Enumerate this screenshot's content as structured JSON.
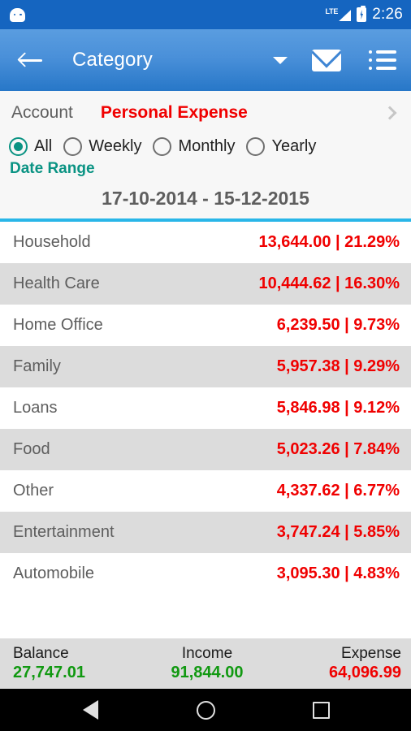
{
  "status_bar": {
    "left_icon": "android-head-icon",
    "network_label": "LTE",
    "signal_icon": "signal-triangle-icon",
    "battery_icon": "battery-charging-icon",
    "time": "2:26"
  },
  "toolbar": {
    "back_icon": "back-arrow-icon",
    "title": "Category",
    "dropdown_icon": "chevron-down-icon",
    "mail_icon": "mail-icon",
    "list_icon": "list-icon"
  },
  "filters": {
    "account_label": "Account",
    "account_value": "Personal Expense",
    "chevron_icon": "chevron-right-icon",
    "period_options": [
      {
        "label": "All",
        "selected": true
      },
      {
        "label": "Weekly",
        "selected": false
      },
      {
        "label": "Monthly",
        "selected": false
      },
      {
        "label": "Yearly",
        "selected": false
      }
    ],
    "date_range_label": "Date Range",
    "date_range_value": "17-10-2014 - 15-12-2015"
  },
  "categories": [
    {
      "name": "Household",
      "value": "13,644.00 | 21.29%",
      "amount": 13644.0,
      "percent": 21.29
    },
    {
      "name": "Health Care",
      "value": "10,444.62 | 16.30%",
      "amount": 10444.62,
      "percent": 16.3
    },
    {
      "name": "Home Office",
      "value": "6,239.50 | 9.73%",
      "amount": 6239.5,
      "percent": 9.73
    },
    {
      "name": "Family",
      "value": "5,957.38 | 9.29%",
      "amount": 5957.38,
      "percent": 9.29
    },
    {
      "name": "Loans",
      "value": "5,846.98 | 9.12%",
      "amount": 5846.98,
      "percent": 9.12
    },
    {
      "name": "Food",
      "value": "5,023.26 | 7.84%",
      "amount": 5023.26,
      "percent": 7.84
    },
    {
      "name": "Other",
      "value": "4,337.62 | 6.77%",
      "amount": 4337.62,
      "percent": 6.77
    },
    {
      "name": "Entertainment",
      "value": "3,747.24 | 5.85%",
      "amount": 3747.24,
      "percent": 5.85
    },
    {
      "name": "Automobile",
      "value": "3,095.30 | 4.83%",
      "amount": 3095.3,
      "percent": 4.83
    }
  ],
  "summary": {
    "balance_label": "Balance",
    "balance_value": "27,747.01",
    "income_label": "Income",
    "income_value": "91,844.00",
    "expense_label": "Expense",
    "expense_value": "64,096.99"
  },
  "navbar": {
    "back_icon": "nav-back-icon",
    "home_icon": "nav-home-icon",
    "recents_icon": "nav-recents-icon"
  },
  "colors": {
    "status_bar": "#1565c0",
    "toolbar_top": "#5a9de0",
    "toolbar_bottom": "#2777c8",
    "accent_line": "#29b6e8",
    "expense_red": "#f00000",
    "income_green": "#119911",
    "teal": "#0a9383",
    "row_alt": "#dcdcdc"
  }
}
